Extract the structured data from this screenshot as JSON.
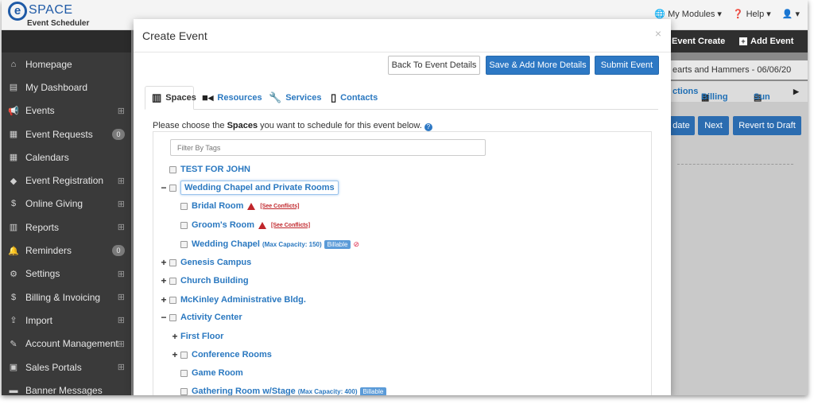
{
  "app": {
    "logo_e": "e",
    "logo_word": "SPACE",
    "logo_sub": "Event Scheduler"
  },
  "topbar": {
    "my_modules": "My Modules",
    "help": "Help",
    "user_caret": "▾"
  },
  "sidebar": {
    "items": [
      {
        "label": "Homepage",
        "icon": "home-icon",
        "glyph": "⌂",
        "extra": ""
      },
      {
        "label": "My Dashboard",
        "icon": "dashboard-icon",
        "glyph": "▤",
        "extra": ""
      },
      {
        "label": "Events",
        "icon": "megaphone-icon",
        "glyph": "📢",
        "extra": "⊞"
      },
      {
        "label": "Event Requests",
        "icon": "calendar-icon",
        "glyph": "▦",
        "extra": "0"
      },
      {
        "label": "Calendars",
        "icon": "calendar-icon",
        "glyph": "▦",
        "extra": ""
      },
      {
        "label": "Event Registration",
        "icon": "tag-icon",
        "glyph": "◆",
        "extra": "⊞"
      },
      {
        "label": "Online Giving",
        "icon": "dollar-icon",
        "glyph": "$",
        "extra": "⊞"
      },
      {
        "label": "Reports",
        "icon": "report-icon",
        "glyph": "▥",
        "extra": "⊞"
      },
      {
        "label": "Reminders",
        "icon": "bell-icon",
        "glyph": "🔔",
        "extra": "0"
      },
      {
        "label": "Settings",
        "icon": "gear-icon",
        "glyph": "⚙",
        "extra": "⊞"
      },
      {
        "label": "Billing & Invoicing",
        "icon": "dollar-icon",
        "glyph": "$",
        "extra": "⊞"
      },
      {
        "label": "Import",
        "icon": "upload-icon",
        "glyph": "⇪",
        "extra": "⊞"
      },
      {
        "label": "Account Management",
        "icon": "wrench-icon",
        "glyph": "✎",
        "extra": "⊞"
      },
      {
        "label": "Sales Portals",
        "icon": "money-icon",
        "glyph": "▣",
        "extra": "⊞"
      },
      {
        "label": "Banner Messages",
        "icon": "banner-icon",
        "glyph": "▬",
        "extra": ""
      }
    ]
  },
  "background": {
    "event_create": "Event Create",
    "add_event": "Add Event",
    "event_name": "earts and Hammers - 06/06/20",
    "tab_ctions": "ctions",
    "tab_billing": "Billing",
    "tab_sun": "Sun",
    "btn_update": "date",
    "btn_next": "Next",
    "btn_revert": "Revert to Draft"
  },
  "modal": {
    "title": "Create Event",
    "close": "×",
    "back_button": "Back To Event Details",
    "save_button": "Save & Add More Details",
    "submit_button": "Submit Event",
    "tabs": [
      {
        "label": "Spaces",
        "icon": "building-icon"
      },
      {
        "label": "Resources",
        "icon": "video-camera-icon"
      },
      {
        "label": "Services",
        "icon": "wrench-icon"
      },
      {
        "label": "Contacts",
        "icon": "address-book-icon"
      }
    ],
    "prompt_pre": "Please choose the ",
    "prompt_bold": "Spaces",
    "prompt_post": " you want to schedule for this event below.",
    "filter_placeholder": "Filter By Tags",
    "see_conflicts": "[See Conflicts]",
    "billable": "Billable",
    "tree": [
      {
        "label": "TEST FOR JOHN",
        "toggle": "",
        "checkbox": true,
        "level": 0
      },
      {
        "label": "Wedding Chapel and Private Rooms",
        "toggle": "−",
        "checkbox": true,
        "level": 0,
        "focused": true
      },
      {
        "label": "Bridal Room",
        "toggle": "",
        "checkbox": true,
        "level": 1,
        "conflict": true
      },
      {
        "label": "Groom's Room",
        "toggle": "",
        "checkbox": true,
        "level": 1,
        "conflict": true
      },
      {
        "label": "Wedding Chapel",
        "toggle": "",
        "checkbox": true,
        "level": 1,
        "capacity": "(Max Capacity: 150)",
        "billable": true,
        "no_bill": "⊘"
      },
      {
        "label": "Genesis Campus",
        "toggle": "+",
        "checkbox": true,
        "level": 0
      },
      {
        "label": "Church Building",
        "toggle": "+",
        "checkbox": true,
        "level": 0
      },
      {
        "label": "McKinley Administrative Bldg.",
        "toggle": "+",
        "checkbox": true,
        "level": 0
      },
      {
        "label": "Activity Center",
        "toggle": "−",
        "checkbox": true,
        "level": 0
      },
      {
        "label": "First Floor",
        "toggle": "+",
        "checkbox": false,
        "level": 1
      },
      {
        "label": "Conference Rooms",
        "toggle": "+",
        "checkbox": true,
        "level": 1
      },
      {
        "label": "Game Room",
        "toggle": "",
        "checkbox": true,
        "level": 1
      },
      {
        "label": "Gathering Room w/Stage",
        "toggle": "",
        "checkbox": true,
        "level": 1,
        "capacity": "(Max Capacity: 400)",
        "billable": true
      }
    ]
  }
}
